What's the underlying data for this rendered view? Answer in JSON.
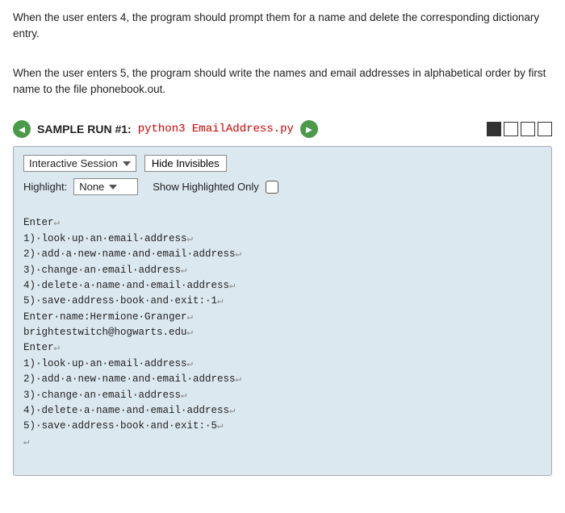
{
  "description": {
    "para1": "When the user enters 4, the program should prompt them for a name and delete the corresponding dictionary entry.",
    "para2": "When the user enters 5, the program should write the names and email addresses in alphabetical order by first name to the file phonebook.out."
  },
  "sample_run": {
    "label": "SAMPLE RUN #1:",
    "code": "python3 EmailAddress.py",
    "left_arrow": "◄",
    "right_arrow": "►"
  },
  "toolbar": {
    "session_label": "Interactive Session",
    "hide_invisibles": "Hide Invisibles",
    "highlight_label": "Highlight:",
    "highlight_value": "None",
    "show_highlighted": "Show Highlighted Only"
  },
  "terminal_lines": [
    "Enter↵",
    "1)·look·up·an·email·address↵",
    "2)·add·a·new·name·and·email·address↵",
    "3)·change·an·email·address↵",
    "4)·delete·a·name·and·email·address↵",
    "5)·save·address·book·and·exit:·1↵",
    "Enter·name:Hermione·Granger↵",
    "brightestwitch@hogwarts.edu↵",
    "Enter↵",
    "1)·look·up·an·email·address↵",
    "2)·add·a·new·name·and·email·address↵",
    "3)·change·an·email·address↵",
    "4)·delete·a·name·and·email·address↵",
    "5)·save·address·book·and·exit:·5↵",
    "↵"
  ]
}
